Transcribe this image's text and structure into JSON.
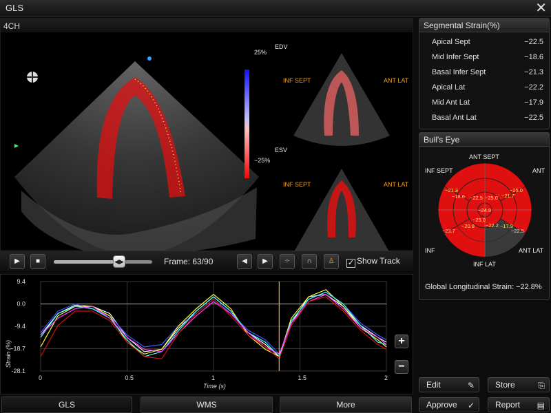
{
  "window": {
    "title": "GLS",
    "close_icon": "close-icon"
  },
  "viewer": {
    "view_label": "4CH",
    "color_bar_top": "25%",
    "color_bar_bottom": "−25%",
    "edv_label": "EDV",
    "esv_label": "ESV",
    "edv_left": "INF SEPT",
    "edv_right": "ANT LAT",
    "esv_left": "INF SEPT",
    "esv_right": "ANT LAT"
  },
  "playback": {
    "frame_text": "Frame: 63/90",
    "frame_current": 63,
    "frame_total": 90,
    "show_track_label": "Show Track",
    "show_track_checked": true,
    "play_icon": "▶",
    "stop_icon": "■",
    "prev_icon": "◀",
    "next_icon": "▶",
    "thumb_icon": "◀▶"
  },
  "chart_data": {
    "type": "line",
    "xlabel": "Time (s)",
    "ylabel": "Strain (%)",
    "xlim": [
      0,
      2
    ],
    "ylim": [
      -28.1,
      9.4
    ],
    "x_ticks": [
      "0",
      "0.5",
      "1",
      "1.5",
      "2"
    ],
    "y_ticks": [
      "9.4",
      "0.0",
      "-9.4",
      "-18.7",
      "-28.1"
    ],
    "cursor_x": 1.38,
    "x": [
      0,
      0.1,
      0.2,
      0.3,
      0.4,
      0.5,
      0.6,
      0.7,
      0.8,
      0.9,
      1.0,
      1.1,
      1.2,
      1.3,
      1.38,
      1.45,
      1.55,
      1.65,
      1.75,
      1.85,
      1.95,
      2.0
    ],
    "series": [
      {
        "color": "#ffffff",
        "values": [
          -13,
          -4,
          -0.5,
          -1,
          -4,
          -14,
          -20,
          -19,
          -10,
          -3,
          3,
          -3,
          -12,
          -17,
          -22,
          -8,
          3,
          4,
          -1,
          -9,
          -14,
          -16
        ]
      },
      {
        "color": "#3a5bff",
        "values": [
          -12,
          -3,
          0,
          -2,
          -5,
          -13,
          -18,
          -17,
          -9,
          -4,
          2,
          -4,
          -11,
          -15,
          -21,
          -9,
          2,
          5,
          0,
          -8,
          -13,
          -15
        ]
      },
      {
        "color": "#ffff40",
        "values": [
          -18,
          -5,
          -1,
          -1,
          -5,
          -16,
          -21,
          -19,
          -9,
          -2,
          4,
          -2,
          -13,
          -19,
          -22,
          -6,
          3,
          6,
          -1,
          -10,
          -15,
          -18
        ]
      },
      {
        "color": "#40ffff",
        "values": [
          -14,
          -4,
          -1,
          -2,
          -6,
          -15,
          -22,
          -20,
          -11,
          -3,
          3,
          -3,
          -12,
          -16,
          -22,
          -7,
          2,
          5,
          0,
          -9,
          -16,
          -17
        ]
      },
      {
        "color": "#ff40ff",
        "values": [
          -13,
          -6,
          -2,
          -1,
          -6,
          -14,
          -19,
          -20,
          -12,
          -5,
          1,
          -4,
          -12,
          -18,
          -21,
          -8,
          1,
          4,
          -2,
          -10,
          -14,
          -17
        ]
      },
      {
        "color": "#d01010",
        "values": [
          -22,
          -9,
          -3,
          -3,
          -7,
          -16,
          -22,
          -23,
          -12,
          -4,
          2,
          -5,
          -13,
          -18,
          -23,
          -9,
          1,
          3,
          -3,
          -11,
          -17,
          -19
        ]
      }
    ]
  },
  "graph_buttons": {
    "zoom_in": "+",
    "zoom_out": "−"
  },
  "bottom_tabs": [
    "GLS",
    "WMS",
    "More"
  ],
  "segmental": {
    "title": "Segmental Strain(%)",
    "rows": [
      {
        "label": "Apical Sept",
        "value": "−22.5"
      },
      {
        "label": "Mid Infer Sept",
        "value": "−18.6"
      },
      {
        "label": "Basal Infer Sept",
        "value": "−21.3"
      },
      {
        "label": "Apical Lat",
        "value": "−22.2"
      },
      {
        "label": "Mid Ant Lat",
        "value": "−17.9"
      },
      {
        "label": "Basal Ant Lat",
        "value": "−22.5"
      }
    ]
  },
  "bullseye": {
    "title": "Bull's Eye",
    "labels": {
      "ant_sept": "ANT SEPT",
      "inf_sept": "INF SEPT",
      "ant": "ANT",
      "inf": "INF",
      "ant_lat": "ANT LAT",
      "inf_lat": "INF LAT"
    },
    "values": {
      "center": "−24.9",
      "apical_sept": "−22.5",
      "apical_ant": "−25.0",
      "apical_lat": "−22.2",
      "apical_inf": "−25.0",
      "mid_inf_sept": "−18.6",
      "mid_ant_lat": "−21.7",
      "mid_inf": "−20.8",
      "mid_lat_lower": "−17.9",
      "basal_inf_sept": "−21.3",
      "basal_ant_lat": "−25.0",
      "basal_inf": "−23.7",
      "basal_lat": "−22.5"
    },
    "gls_text": "Global Longitudinal Strain: −22.8%"
  },
  "actions": {
    "edit": "Edit",
    "store": "Store",
    "approve": "Approve",
    "report": "Report"
  },
  "colors": {
    "accent_cursor": "#e8a030",
    "strain_red": "#e01010",
    "segment_gray": "#3a3a3a"
  }
}
